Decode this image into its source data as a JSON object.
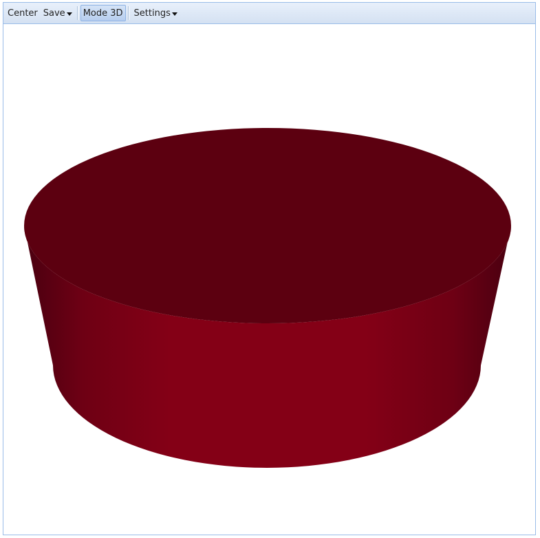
{
  "toolbar": {
    "center_label": "Center",
    "save_label": "Save",
    "mode_label": "Mode 3D",
    "settings_label": "Settings"
  },
  "scene": {
    "object": "cylinder",
    "top_color": "#5c0010",
    "side_color": "#840016",
    "side_edge_color": "#4a0010",
    "background": "#ffffff"
  }
}
